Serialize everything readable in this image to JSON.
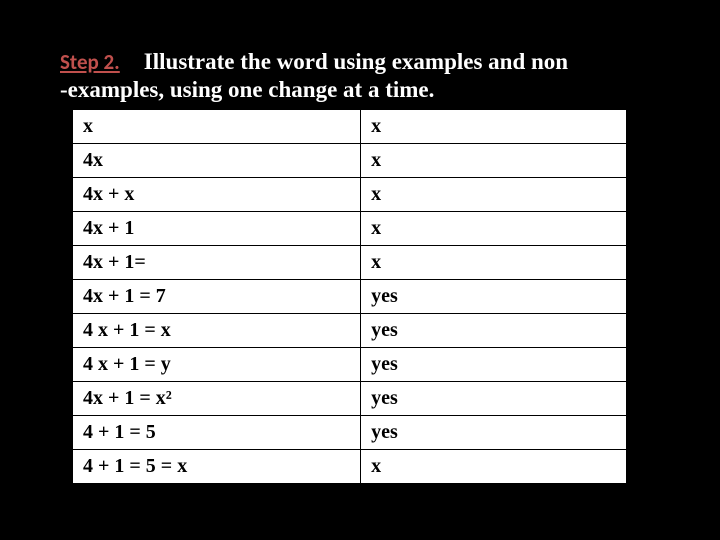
{
  "heading": {
    "step_label": "Step 2.",
    "text_line1": "Illustrate the word using examples and non",
    "text_line2": "-examples, using one change at a time."
  },
  "table": {
    "rows": [
      {
        "expr": "x",
        "result": "x"
      },
      {
        "expr": "4x",
        "result": "x"
      },
      {
        "expr": "4x + x",
        "result": "x"
      },
      {
        "expr": "4x + 1",
        "result": "x"
      },
      {
        "expr": "4x + 1=",
        "result": "x"
      },
      {
        "expr": "4x + 1 = 7",
        "result": "yes"
      },
      {
        "expr": "4 x + 1 = x",
        "result": "yes"
      },
      {
        "expr": "4 x + 1 = y",
        "result": "yes"
      },
      {
        "expr": "4x + 1   = x²",
        "result": "yes"
      },
      {
        "expr": "4 + 1 = 5",
        "result": "yes"
      },
      {
        "expr": "4 + 1 = 5 = x",
        "result": "x"
      }
    ]
  }
}
